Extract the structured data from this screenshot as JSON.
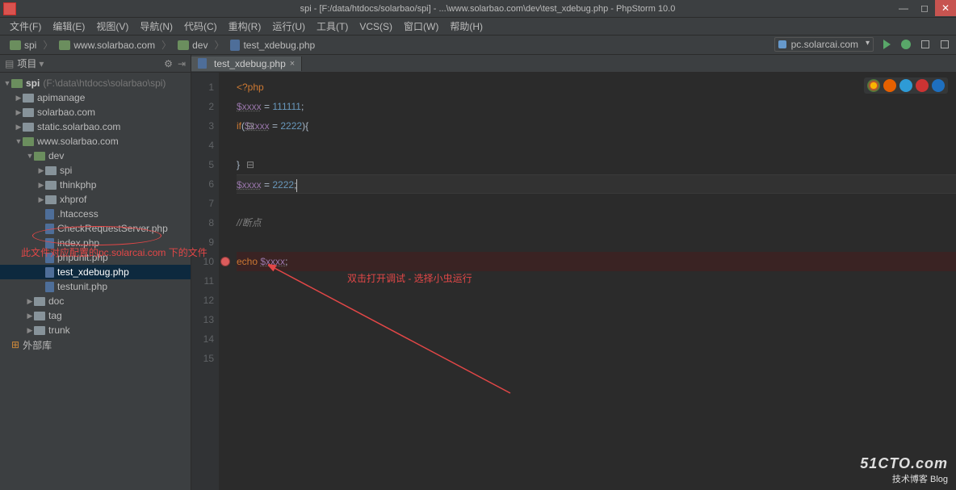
{
  "window": {
    "title": "spi - [F:/data/htdocs/solarbao/spi] - ...\\www.solarbao.com\\dev\\test_xdebug.php - PhpStorm 10.0"
  },
  "menu": [
    "文件(F)",
    "编辑(E)",
    "视图(V)",
    "导航(N)",
    "代码(C)",
    "重构(R)",
    "运行(U)",
    "工具(T)",
    "VCS(S)",
    "窗口(W)",
    "帮助(H)"
  ],
  "breadcrumbs": [
    {
      "icon": "folder",
      "label": "spi"
    },
    {
      "icon": "folder",
      "label": "www.solarbao.com"
    },
    {
      "icon": "folder",
      "label": "dev"
    },
    {
      "icon": "php",
      "label": "test_xdebug.php"
    }
  ],
  "runconfig": "pc.solarcai.com",
  "project": {
    "panel_label": "项目",
    "root": {
      "label": "spi",
      "hint": "(F:\\data\\htdocs\\solarbao\\spi)"
    },
    "tree": [
      {
        "d": 1,
        "t": "fc",
        "tw": "▶",
        "label": "apimanage"
      },
      {
        "d": 1,
        "t": "fc",
        "tw": "▶",
        "label": "solarbao.com"
      },
      {
        "d": 1,
        "t": "fc",
        "tw": "▶",
        "label": "static.solarbao.com"
      },
      {
        "d": 1,
        "t": "fo",
        "tw": "▼",
        "label": "www.solarbao.com"
      },
      {
        "d": 2,
        "t": "fo",
        "tw": "▼",
        "label": "dev"
      },
      {
        "d": 3,
        "t": "fc",
        "tw": "▶",
        "label": "spi"
      },
      {
        "d": 3,
        "t": "fc",
        "tw": "▶",
        "label": "thinkphp"
      },
      {
        "d": 3,
        "t": "fc",
        "tw": "▶",
        "label": "xhprof"
      },
      {
        "d": 3,
        "t": "f",
        "tw": "",
        "label": ".htaccess"
      },
      {
        "d": 3,
        "t": "f",
        "tw": "",
        "label": "CheckRequestServer.php"
      },
      {
        "d": 3,
        "t": "f",
        "tw": "",
        "label": "index.php"
      },
      {
        "d": 3,
        "t": "f",
        "tw": "",
        "label": "phpunit.php"
      },
      {
        "d": 3,
        "t": "f",
        "tw": "",
        "label": "test_xdebug.php",
        "sel": true
      },
      {
        "d": 3,
        "t": "f",
        "tw": "",
        "label": "testunit.php"
      },
      {
        "d": 2,
        "t": "fc",
        "tw": "▶",
        "label": "doc"
      },
      {
        "d": 2,
        "t": "fc",
        "tw": "▶",
        "label": "tag"
      },
      {
        "d": 2,
        "t": "fc",
        "tw": "▶",
        "label": "trunk"
      }
    ],
    "ext_lib": "外部库"
  },
  "tab": {
    "label": "test_xdebug.php"
  },
  "code": {
    "lines": [
      {
        "n": 1,
        "html": "<span class='tag'>&lt;?php</span>"
      },
      {
        "n": 2,
        "html": "<span class='var'>$xxxx</span> = <span class='num'>111111</span>;"
      },
      {
        "n": 3,
        "html": "<span class='kw'>if</span>(<span class='var'>$xxxx</span> = <span class='num'>2222</span>){",
        "fold": "⊟"
      },
      {
        "n": 4,
        "html": ""
      },
      {
        "n": 5,
        "html": "}",
        "fold": "⊟"
      },
      {
        "n": 6,
        "html": "<span class='var'>$xxxx</span> = <span class='num'>2222</span>;<span class='cursor'></span>",
        "cur": true
      },
      {
        "n": 7,
        "html": ""
      },
      {
        "n": 8,
        "html": "<span class='cmt'>//断点</span>"
      },
      {
        "n": 9,
        "html": ""
      },
      {
        "n": 10,
        "html": "<span class='kw'>echo</span> <span class='var'>$xxxx</span>;",
        "bp": true
      },
      {
        "n": 11,
        "html": ""
      },
      {
        "n": 12,
        "html": ""
      },
      {
        "n": 13,
        "html": ""
      },
      {
        "n": 14,
        "html": ""
      },
      {
        "n": 15,
        "html": ""
      }
    ]
  },
  "annotations": {
    "tree_note": "此文件对应配置的pc.solarcai.com 下的文件",
    "editor_note": "双击打开调试 - 选择小虫运行"
  },
  "watermark": {
    "line1": "51CTO.com",
    "line2": "技术博客  Blog"
  }
}
